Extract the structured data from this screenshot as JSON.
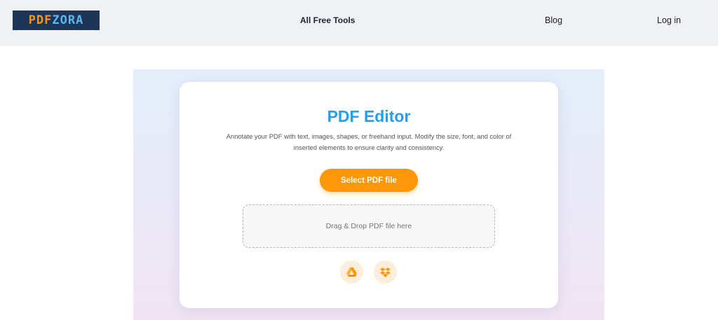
{
  "header": {
    "logo": {
      "text_pdf": "PDF",
      "text_zora": "ZORA",
      "background": "#1d3658",
      "pdf_color": "#f7941d",
      "zora_color": "#5ab7f0"
    },
    "nav": {
      "tools_label": "All Free Tools",
      "blog_label": "Blog",
      "login_label": "Log in"
    }
  },
  "main": {
    "title": "PDF Editor",
    "description": "Annotate your PDF with text, images, shapes, or freehand input. Modify the size, font, and color of inserted elements to ensure clarity and consistency.",
    "select_button_label": "Select PDF file",
    "dropzone_text": "Drag & Drop PDF file here",
    "cloud_sources": [
      {
        "icon": "google-drive-icon"
      },
      {
        "icon": "dropbox-icon"
      }
    ]
  },
  "colors": {
    "accent": "#ff9808",
    "title": "#2a9de8",
    "header_bg": "#f0f1f5"
  }
}
